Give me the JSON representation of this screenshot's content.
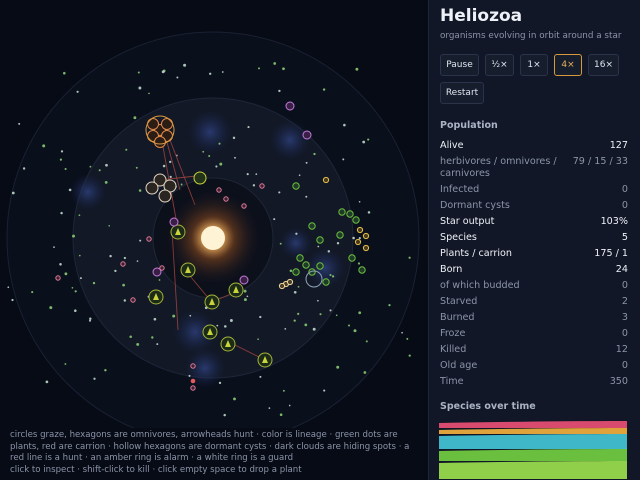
{
  "app": {
    "title": "Heliozoa",
    "subtitle": "organisms evolving in orbit around a star"
  },
  "speed_buttons": [
    {
      "label": "Pause",
      "active": false
    },
    {
      "label": "½×",
      "active": false
    },
    {
      "label": "1×",
      "active": false
    },
    {
      "label": "4×",
      "active": true
    },
    {
      "label": "16×",
      "active": false
    }
  ],
  "restart_label": "Restart",
  "population": {
    "title": "Population",
    "rows": [
      {
        "label": "Alive",
        "value": "127",
        "highlight": true
      },
      {
        "label": "herbivores / omnivores / carnivores",
        "value": "79 / 15 / 33",
        "highlight": false
      },
      {
        "label": "Infected",
        "value": "0",
        "highlight": false
      },
      {
        "label": "Dormant cysts",
        "value": "0",
        "highlight": false
      },
      {
        "label": "Star output",
        "value": "103%",
        "highlight": true
      },
      {
        "label": "Species",
        "value": "5",
        "highlight": true
      },
      {
        "label": "Plants / carrion",
        "value": "175 / 1",
        "highlight": true
      },
      {
        "label": "Born",
        "value": "24",
        "highlight": true
      },
      {
        "label": "of which budded",
        "value": "0",
        "highlight": false
      },
      {
        "label": "Starved",
        "value": "2",
        "highlight": false
      },
      {
        "label": "Burned",
        "value": "3",
        "highlight": false
      },
      {
        "label": "Froze",
        "value": "0",
        "highlight": false
      },
      {
        "label": "Killed",
        "value": "12",
        "highlight": false
      },
      {
        "label": "Old age",
        "value": "0",
        "highlight": false
      },
      {
        "label": "Time",
        "value": "350",
        "highlight": false
      }
    ]
  },
  "species_chart": {
    "title": "Species over time",
    "colors": [
      "#d94b6e",
      "#e0a23a",
      "#3fb7c9",
      "#6bbf3e",
      "#8fcf4a"
    ]
  },
  "legend": {
    "line1": "circles graze, hexagons are omnivores, arrowheads hunt · color is lineage · green dots are plants, red are carrion · hollow hexagons are dormant cysts · dark clouds are hiding spots · a red line is a hunt · an amber ring is alarm · a white ring is a guard",
    "line2": "click to inspect · shift-click to kill · click empty space to drop a plant"
  },
  "colors": {
    "background": "#070b16",
    "panel": "#111726",
    "accent": "#d89a3c",
    "star": "#fff3d6",
    "plant": "#7bd46a",
    "omnivore": "#6bbf3e",
    "hunter": "#c9d33a",
    "lineage_orange": "#e08a4a",
    "lineage_violet": "#c77be0"
  }
}
